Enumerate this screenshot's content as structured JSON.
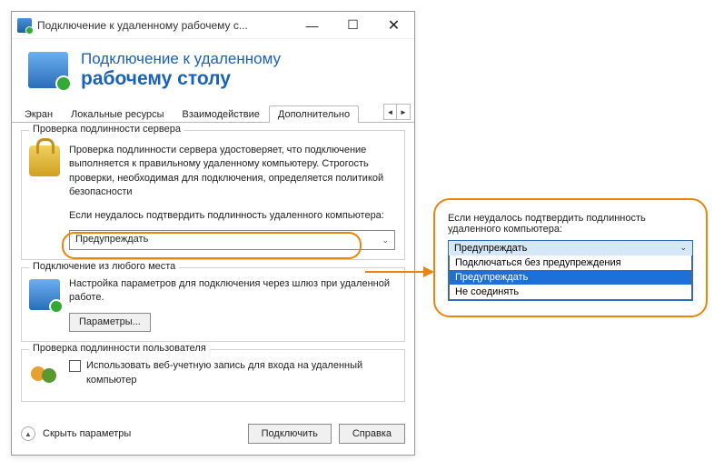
{
  "titlebar": {
    "text": "Подключение к удаленному рабочему с..."
  },
  "banner": {
    "line1": "Подключение к удаленному",
    "line2": "рабочему столу"
  },
  "tabs": {
    "items": [
      "Экран",
      "Локальные ресурсы",
      "Взаимодействие",
      "Дополнительно"
    ],
    "active_index": 3
  },
  "group_auth": {
    "title": "Проверка подлинности сервера",
    "desc": "Проверка подлинности сервера удостоверяет, что подключение выполняется к правильному удаленному компьютеру. Строгость проверки, необходимая для подключения, определяется политикой безопасности",
    "prompt": "Если неудалось подтвердить подлинность удаленного компьютера:",
    "select_value": "Предупреждать"
  },
  "group_gateway": {
    "title": "Подключение из любого места",
    "desc": "Настройка параметров для подключения через шлюз при удаленной работе.",
    "button": "Параметры..."
  },
  "group_userauth": {
    "title": "Проверка подлинности пользователя",
    "checkbox_label": "Использовать веб-учетную запись для входа на удаленный компьютер"
  },
  "footer": {
    "hide": "Скрыть параметры",
    "connect": "Подключить",
    "help": "Справка"
  },
  "callout": {
    "prompt": "Если неудалось подтвердить подлинность удаленного компьютера:",
    "selected": "Предупреждать",
    "options": [
      "Подключаться без предупреждения",
      "Предупреждать",
      "Не соединять"
    ],
    "highlight_index": 1
  },
  "colors": {
    "accent": "#e8850e",
    "link": "#1a62b8"
  }
}
